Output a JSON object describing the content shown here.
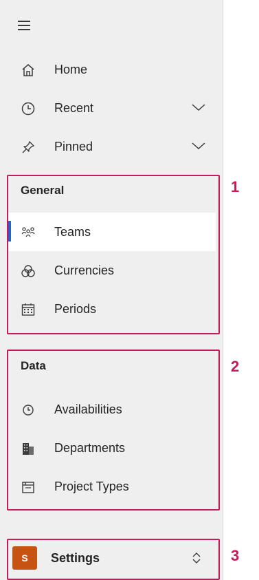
{
  "nav": {
    "home": {
      "label": "Home",
      "icon": "home-icon"
    },
    "recent": {
      "label": "Recent",
      "icon": "clock-icon"
    },
    "pinned": {
      "label": "Pinned",
      "icon": "pin-icon"
    }
  },
  "groups": {
    "general": {
      "header": "General",
      "items": [
        {
          "label": "Teams",
          "icon": "teams-icon",
          "active": true
        },
        {
          "label": "Currencies",
          "icon": "currency-icon"
        },
        {
          "label": "Periods",
          "icon": "calendar-icon"
        }
      ]
    },
    "data": {
      "header": "Data",
      "items": [
        {
          "label": "Availabilities",
          "icon": "clock-icon"
        },
        {
          "label": "Departments",
          "icon": "building-icon"
        },
        {
          "label": "Project Types",
          "icon": "folder-icon"
        }
      ]
    }
  },
  "settings": {
    "avatar_letter": "S",
    "label": "Settings"
  },
  "callouts": [
    "1",
    "2",
    "3"
  ],
  "colors": {
    "accent": "#2563c9",
    "highlight": "#c8195a",
    "avatar": "#c75313"
  }
}
